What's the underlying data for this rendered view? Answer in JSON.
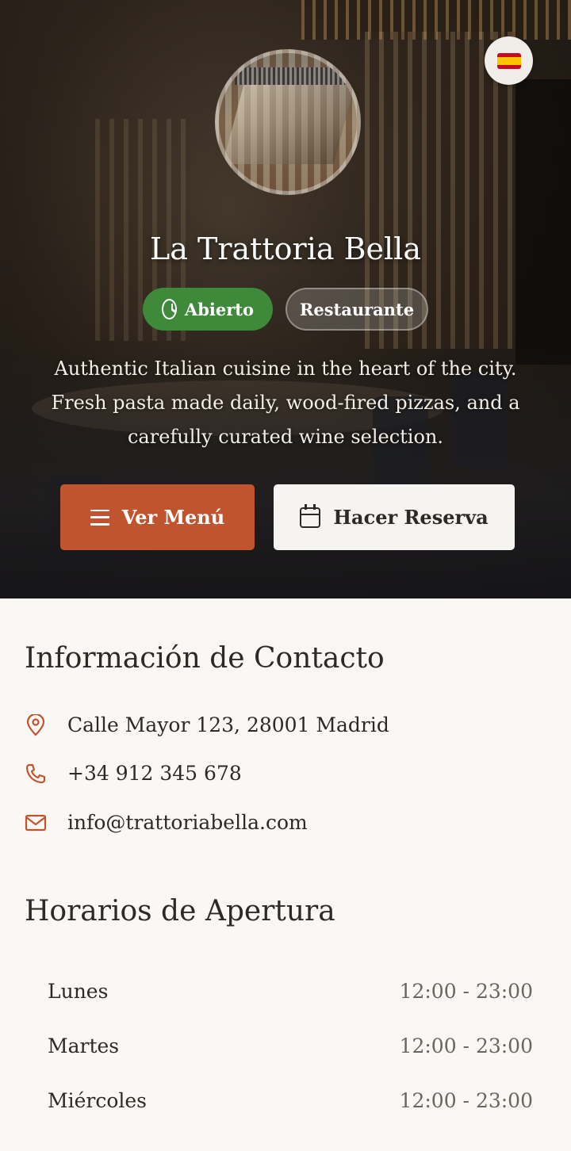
{
  "header": {
    "restaurant_name": "La Trattoria Bella",
    "status_badge": "Abierto",
    "category_badge": "Restaurante",
    "description": "Authentic Italian cuisine in the heart of the city. Fresh pasta made daily, wood-fired pizzas, and a carefully curated wine selection.",
    "language_icon": "spain-flag-icon"
  },
  "actions": {
    "menu_label": "Ver Menú",
    "menu_icon": "menu-icon",
    "reservation_label": "Hacer Reserva",
    "reservation_icon": "calendar-icon"
  },
  "contact": {
    "title": "Información de Contacto",
    "address": "Calle Mayor 123, 28001 Madrid",
    "phone": "+34 912 345 678",
    "email": "info@trattoriabella.com"
  },
  "hours": {
    "title": "Horarios de Apertura",
    "days": [
      {
        "day": "Lunes",
        "time": "12:00 - 23:00"
      },
      {
        "day": "Martes",
        "time": "12:00 - 23:00"
      },
      {
        "day": "Miércoles",
        "time": "12:00 - 23:00"
      }
    ]
  },
  "colors": {
    "accent": "#c0542f",
    "open_green": "#3f8a3a",
    "background": "#faf8f4",
    "text": "#2d2a26"
  }
}
